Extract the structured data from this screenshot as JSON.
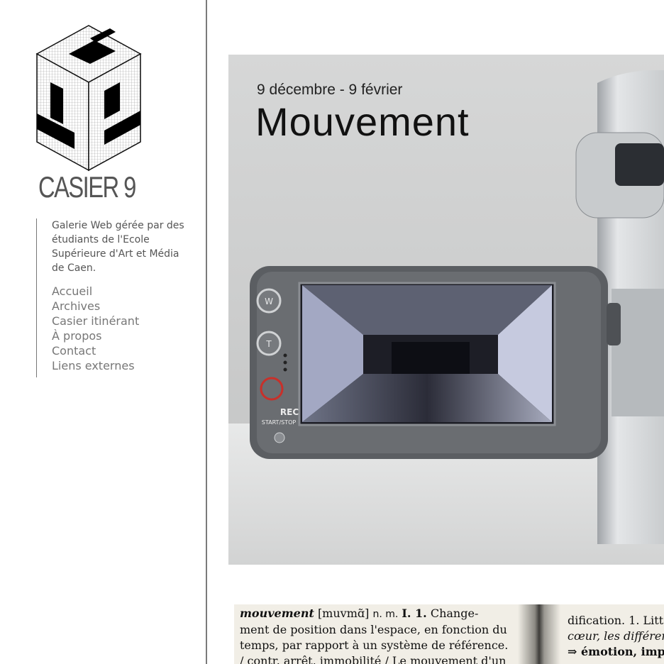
{
  "site": {
    "name": "CASIER 9",
    "description": "Galerie Web gérée par des étudiants de l'Ecole Supérieure d'Art et Média de Caen."
  },
  "nav": {
    "items": [
      {
        "label": "Accueil"
      },
      {
        "label": "Archives"
      },
      {
        "label": "Casier itinérant"
      },
      {
        "label": "À propos"
      },
      {
        "label": "Contact"
      },
      {
        "label": "Liens externes"
      }
    ]
  },
  "poster": {
    "dates": "9 décembre - 9 février",
    "title": "Mouvement",
    "camera_labels": {
      "zoom_wide": "W",
      "zoom_tele": "T",
      "rec": "REC",
      "start_stop": "START/STOP"
    }
  },
  "dictionary": {
    "left": {
      "headword": "mouvement",
      "phonetic": "[muvmɑ̃]",
      "pos": "n. m.",
      "sense": "I. 1.",
      "line1_tail": "Change-",
      "line2": "ment de position dans l'espace, en fonction du",
      "line3": "temps, par rapport à un système de référence.",
      "line4": "/ contr. arrêt, immobilité / Le mouvement d'un"
    },
    "right": {
      "line1": "dification. 1. Litt",
      "line2": "cœur, les différer",
      "line3": "⇒ émotion, imp"
    }
  },
  "colors": {
    "sidebar_rule": "#7a7a7a",
    "text_gray": "#555555",
    "link_gray": "#777777",
    "rec_red": "#c8302a"
  }
}
